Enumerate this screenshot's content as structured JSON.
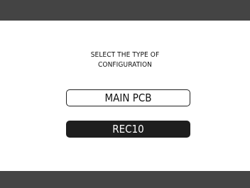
{
  "prompt": {
    "line1": "SELECT THE TYPE OF",
    "line2": "CONFIGURATION"
  },
  "options": [
    {
      "label": "MAIN PCB",
      "selected": false
    },
    {
      "label": "REC10",
      "selected": true
    }
  ],
  "colors": {
    "bar": "#444444",
    "background": "#ffffff",
    "selected_bg": "#1e1e1e",
    "selected_text": "#ffffff",
    "border": "#222222"
  }
}
